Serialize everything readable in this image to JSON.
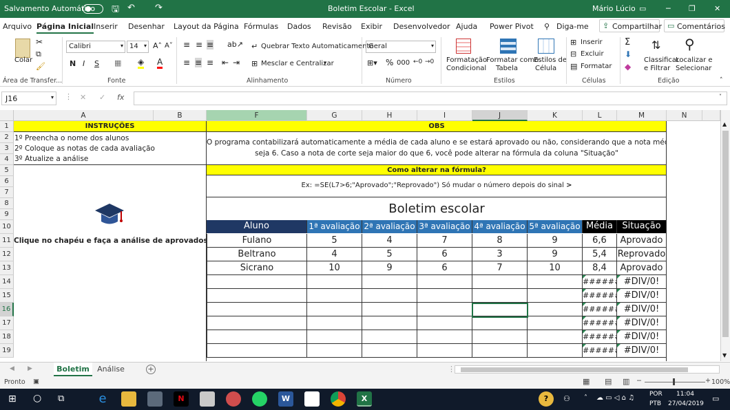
{
  "titlebar": {
    "autosave_label": "Salvamento Automático",
    "title": "Boletim Escolar  -  Excel",
    "user": "Mário Lúcio"
  },
  "ribbon_tabs": [
    "Arquivo",
    "Página Inicial",
    "Inserir",
    "Desenhar",
    "Layout da Página",
    "Fórmulas",
    "Dados",
    "Revisão",
    "Exibir",
    "Desenvolvedor",
    "Ajuda",
    "Power Pivot"
  ],
  "tell_me": "Diga-me",
  "share_label": "Compartilhar",
  "comments_label": "Comentários",
  "ribbon": {
    "paste_label": "Colar",
    "clipboard_group": "Área de Transfer...",
    "font_name": "Calibri",
    "font_size": "14",
    "font_group": "Fonte",
    "bold": "N",
    "italic": "I",
    "underline": "S",
    "wrap_text": "Quebrar Texto Automaticamente",
    "merge_center": "Mesclar e Centralizar",
    "alignment_group": "Alinhamento",
    "number_format": "Geral",
    "number_group": "Número",
    "cond_format": [
      "Formatação",
      "Condicional"
    ],
    "format_table": [
      "Formatar como",
      "Tabela"
    ],
    "cell_styles": [
      "Estilos de",
      "Célula"
    ],
    "styles_group": "Estilos",
    "insert": "Inserir",
    "delete": "Excluir",
    "format": "Formatar",
    "cells_group": "Células",
    "sort_filter": [
      "Classificar",
      "e Filtrar"
    ],
    "find_select": [
      "Localizar e",
      "Selecionar"
    ],
    "editing_group": "Edição"
  },
  "name_box": "J16",
  "formula_fx": "fx",
  "columns": [
    "A",
    "B",
    "F",
    "G",
    "H",
    "I",
    "J",
    "K",
    "L",
    "M",
    "N"
  ],
  "rows": [
    "1",
    "2",
    "3",
    "4",
    "5",
    "6",
    "7",
    "8",
    "9",
    "10",
    "11",
    "12",
    "13",
    "14",
    "15",
    "16",
    "17",
    "18",
    "19"
  ],
  "sheet": {
    "instr_title": "INSTRUÇÕES",
    "instr": [
      "1º Preencha o nome dos alunos",
      "2º Coloque as notas de cada avaliação",
      "3º Atualize a análise"
    ],
    "hat_caption": "Clique no chapéu e faça a análise de aprovados",
    "obs_title": "OBS",
    "obs_line1": "O programa contabilizará automaticamente a média de cada aluno e se estará aprovado ou não, considerando que a nota média para passar",
    "obs_line2": "seja 6. Caso a nota de corte seja maior do que 6, você pode alterar na fórmula da coluna \"Situação\"",
    "howto_title": "Como alterar na fórmula?",
    "howto_example": "Ex: =SE(L7>6;\"Aprovado\";\"Reprovado\") Só mudar o número depois do sinal",
    "howto_sign": ">",
    "board_title": "Boletim escolar",
    "headers": [
      "Aluno",
      "1ª avaliação",
      "2ª avaliação",
      "3ª avaliação",
      "4ª avaliação",
      "5ª avaliação",
      "Média",
      "Situação"
    ],
    "students": [
      {
        "name": "Fulano",
        "grades": [
          "5",
          "4",
          "7",
          "8",
          "9"
        ],
        "avg": "6,6",
        "status": "Aprovado"
      },
      {
        "name": "Beltrano",
        "grades": [
          "4",
          "5",
          "6",
          "3",
          "9"
        ],
        "avg": "5,4",
        "status": "Reprovado"
      },
      {
        "name": "Sicrano",
        "grades": [
          "10",
          "9",
          "6",
          "7",
          "10"
        ],
        "avg": "8,4",
        "status": "Aprovado"
      }
    ],
    "empty_avg": "######",
    "empty_status": "#DIV/0!"
  },
  "sheet_tabs": [
    "Boletim",
    "Análise"
  ],
  "status_text": "Pronto",
  "zoom": "100%",
  "taskbar": {
    "lang1": "POR",
    "lang2": "PTB",
    "time": "11:04",
    "date": "27/04/2019"
  },
  "colors": {
    "excel_green": "#217346",
    "header_navy": "#1f3864",
    "header_blue": "#2f75b5",
    "yellow": "#ffff00"
  }
}
